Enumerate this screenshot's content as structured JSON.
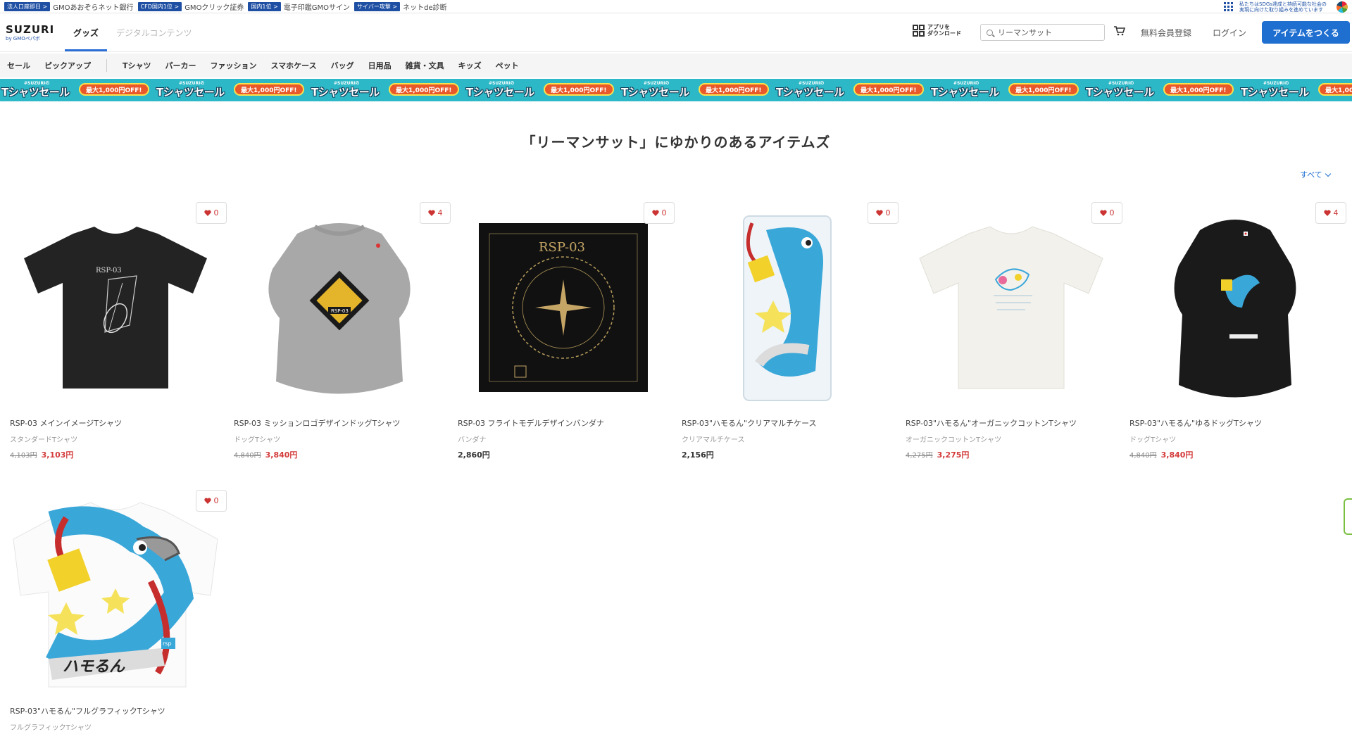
{
  "gmo_bar": {
    "items": [
      {
        "badge": "法人口座即日 >",
        "text": "GMOあおぞらネット銀行"
      },
      {
        "badge": "CFD国内1位 >",
        "text": "GMOクリック証券"
      },
      {
        "badge": "国内1位 >",
        "text": "電子印鑑GMOサイン"
      },
      {
        "badge": "サイバー攻撃 >",
        "text": "ネットde診断"
      }
    ],
    "sdgs_text": "私たちはSDGs達成と持続可能な社会の実現に向けた取り組みを進めています"
  },
  "header": {
    "logo": "SUZURI",
    "logo_sub": "by GMOペパボ",
    "tab_goods": "グッズ",
    "tab_digital": "デジタルコンテンツ",
    "app_download_line1": "アプリを",
    "app_download_line2": "ダウンロード",
    "search_value": "リーマンサット",
    "register": "無料会員登録",
    "login": "ログイン",
    "create_button": "アイテムをつくる"
  },
  "categories": [
    "セール",
    "ピックアップ",
    "Tシャツ",
    "パーカー",
    "ファッション",
    "スマホケース",
    "バッグ",
    "日用品",
    "雑貨・文具",
    "キッズ",
    "ペット"
  ],
  "banner": {
    "sub": "#SUZURIの",
    "title": "Tシャツセール",
    "off": "最大1,000円OFF!"
  },
  "section": {
    "title": "「リーマンサット」にゆかりのあるアイテムズ",
    "see_all": "すべて"
  },
  "products": [
    {
      "title": "RSP-03 メインイメージTシャツ",
      "type": "スタンダードTシャツ",
      "old_price": "4,103円",
      "price": "3,103円",
      "likes": "0"
    },
    {
      "title": "RSP-03 ミッションロゴデザインドッグTシャツ",
      "type": "ドッグTシャツ",
      "old_price": "4,840円",
      "price": "3,840円",
      "likes": "4"
    },
    {
      "title": "RSP-03 フライトモデルデザインバンダナ",
      "type": "バンダナ",
      "old_price": "",
      "price": "2,860円",
      "likes": "0"
    },
    {
      "title": "RSP-03\"ハモるん\"クリアマルチケース",
      "type": "クリアマルチケース",
      "old_price": "",
      "price": "2,156円",
      "likes": "0"
    },
    {
      "title": "RSP-03\"ハモるん\"オーガニックコットンTシャツ",
      "type": "オーガニックコットンTシャツ",
      "old_price": "4,275円",
      "price": "3,275円",
      "likes": "0"
    },
    {
      "title": "RSP-03\"ハモるん\"ゆるドッグTシャツ",
      "type": "ドッグTシャツ",
      "old_price": "4,840円",
      "price": "3,840円",
      "likes": "4"
    },
    {
      "title": "RSP-03\"ハモるん\"フルグラフィックTシャツ",
      "type": "フルグラフィックTシャツ",
      "old_price": "",
      "price": "",
      "likes": "0"
    }
  ],
  "artwork_text": {
    "rsp03": "RSP-03",
    "hamorun": "ハモるん",
    "rsp": "rsp"
  },
  "colors": {
    "accent": "#1f6fd1",
    "sale_price": "#d43a3a",
    "banner_bg": "#2db8c7",
    "banner_off": "#e8582b"
  }
}
